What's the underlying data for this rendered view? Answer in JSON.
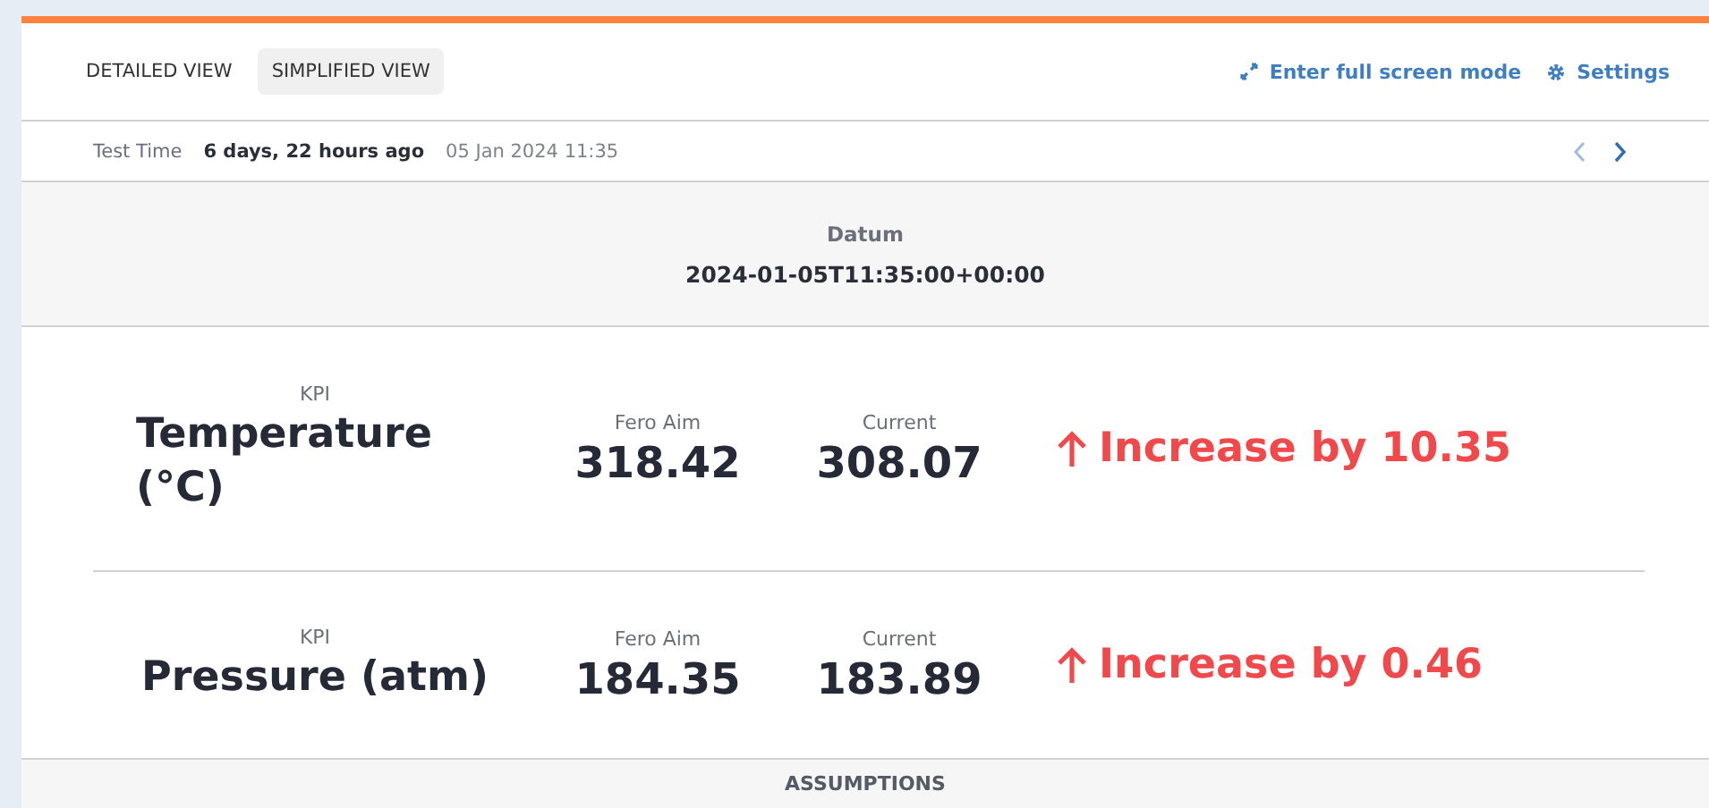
{
  "tabs": [
    {
      "label": "DETAILED VIEW",
      "selected": false
    },
    {
      "label": "SIMPLIFIED VIEW",
      "selected": true
    }
  ],
  "actions": [
    {
      "kind": "fullscreen",
      "label": "Enter full screen mode"
    },
    {
      "kind": "settings",
      "label": "Settings"
    }
  ],
  "test_time": {
    "label": "Test Time",
    "relative": "6 days, 22 hours ago",
    "date": "05 Jan 2024 11:35"
  },
  "datum": {
    "label": "Datum",
    "value": "2024-01-05T11:35:00+00:00"
  },
  "kpis": [
    {
      "kpi_label": "KPI",
      "name": "Temperature (°C)",
      "aim_label": "Fero Aim",
      "aim": "318.42",
      "current_label": "Current",
      "current": "308.07",
      "change": "Increase by 10.35"
    },
    {
      "kpi_label": "KPI",
      "name": "Pressure (atm)",
      "aim_label": "Fero Aim",
      "aim": "184.35",
      "current_label": "Current",
      "current": "183.89",
      "change": "Increase by 0.46"
    }
  ],
  "section_title": "ASSUMPTIONS"
}
